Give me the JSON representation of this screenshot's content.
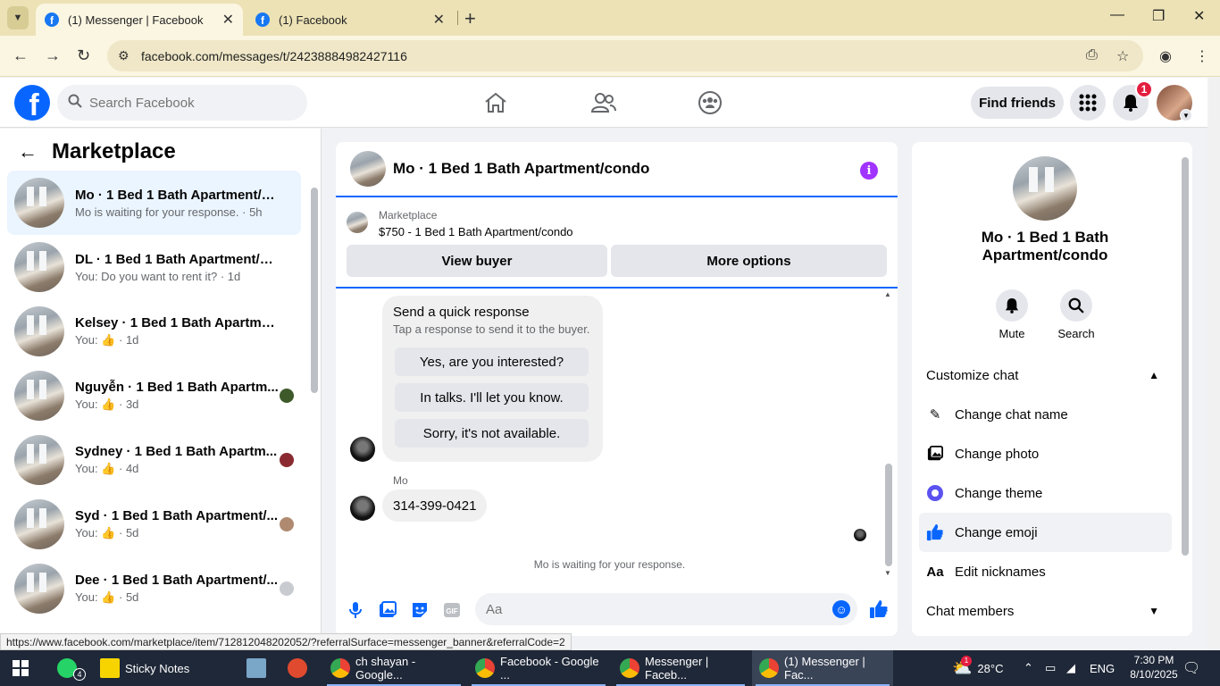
{
  "browser": {
    "tabs": [
      {
        "title": "(1) Messenger | Facebook",
        "active": true
      },
      {
        "title": "(1) Facebook",
        "active": false
      }
    ],
    "url": "facebook.com/messages/t/24238884982427116",
    "status_link": "https://www.facebook.com/marketplace/item/712812048202052/?referralSurface=messenger_banner&referralCode=2"
  },
  "fb": {
    "search_placeholder": "Search Facebook",
    "find_friends": "Find friends",
    "notification_count": "1"
  },
  "left": {
    "title": "Marketplace",
    "conversations": [
      {
        "title": "Mo · 1 Bed 1 Bath Apartment/co...",
        "sub": "Mo is waiting for your response. · 5h",
        "active": true
      },
      {
        "title": "DL · 1 Bed 1 Bath Apartment/con...",
        "sub": "You: Do you want to rent it? · 1d"
      },
      {
        "title": "Kelsey · 1 Bed 1 Bath Apartment/...",
        "sub_prefix": "You:",
        "sub_suffix": "· 1d"
      },
      {
        "title": "Nguyễn · 1 Bed 1 Bath Apartm...",
        "sub_prefix": "You:",
        "sub_suffix": "· 3d"
      },
      {
        "title": "Sydney · 1 Bed 1 Bath Apartm...",
        "sub_prefix": "You:",
        "sub_suffix": "· 4d"
      },
      {
        "title": "Syd · 1 Bed 1 Bath Apartment/...",
        "sub_prefix": "You:",
        "sub_suffix": "· 5d"
      },
      {
        "title": "Dee · 1 Bed 1 Bath Apartment/...",
        "sub_prefix": "You:",
        "sub_suffix": "· 5d"
      }
    ]
  },
  "chat": {
    "title": "Mo · 1 Bed 1 Bath Apartment/condo",
    "marketplace_label": "Marketplace",
    "listing": "$750 - 1 Bed 1 Bath Apartment/condo",
    "view_buyer": "View buyer",
    "more_options": "More options",
    "quick_title": "Send a quick response",
    "quick_sub": "Tap a response to send it to the buyer.",
    "quick_responses": [
      "Yes, are you interested?",
      "In talks. I'll let you know.",
      "Sorry, it's not available."
    ],
    "sender": "Mo",
    "message": "314-399-0421",
    "waiting": "Mo is waiting for your response.",
    "composer_placeholder": "Aa"
  },
  "right": {
    "name": "Mo · 1 Bed 1 Bath Apartment/condo",
    "mute": "Mute",
    "search": "Search",
    "customize": "Customize chat",
    "items": [
      "Change chat name",
      "Change photo",
      "Change theme",
      "Change emoji",
      "Edit nicknames"
    ],
    "members": "Chat members"
  },
  "taskbar": {
    "whatsapp_badge": "4",
    "items": [
      "Sticky Notes",
      "ch shayan - Google...",
      "Facebook - Google ...",
      "Messenger | Faceb...",
      "(1) Messenger | Fac..."
    ],
    "weather": "28°C",
    "lang": "ENG",
    "time": "7:30 PM",
    "date": "8/10/2025",
    "weather_badge": "1"
  },
  "colors": {
    "accent": "#0866ff",
    "info": "#a033ff",
    "badge": "#e41e3f"
  }
}
